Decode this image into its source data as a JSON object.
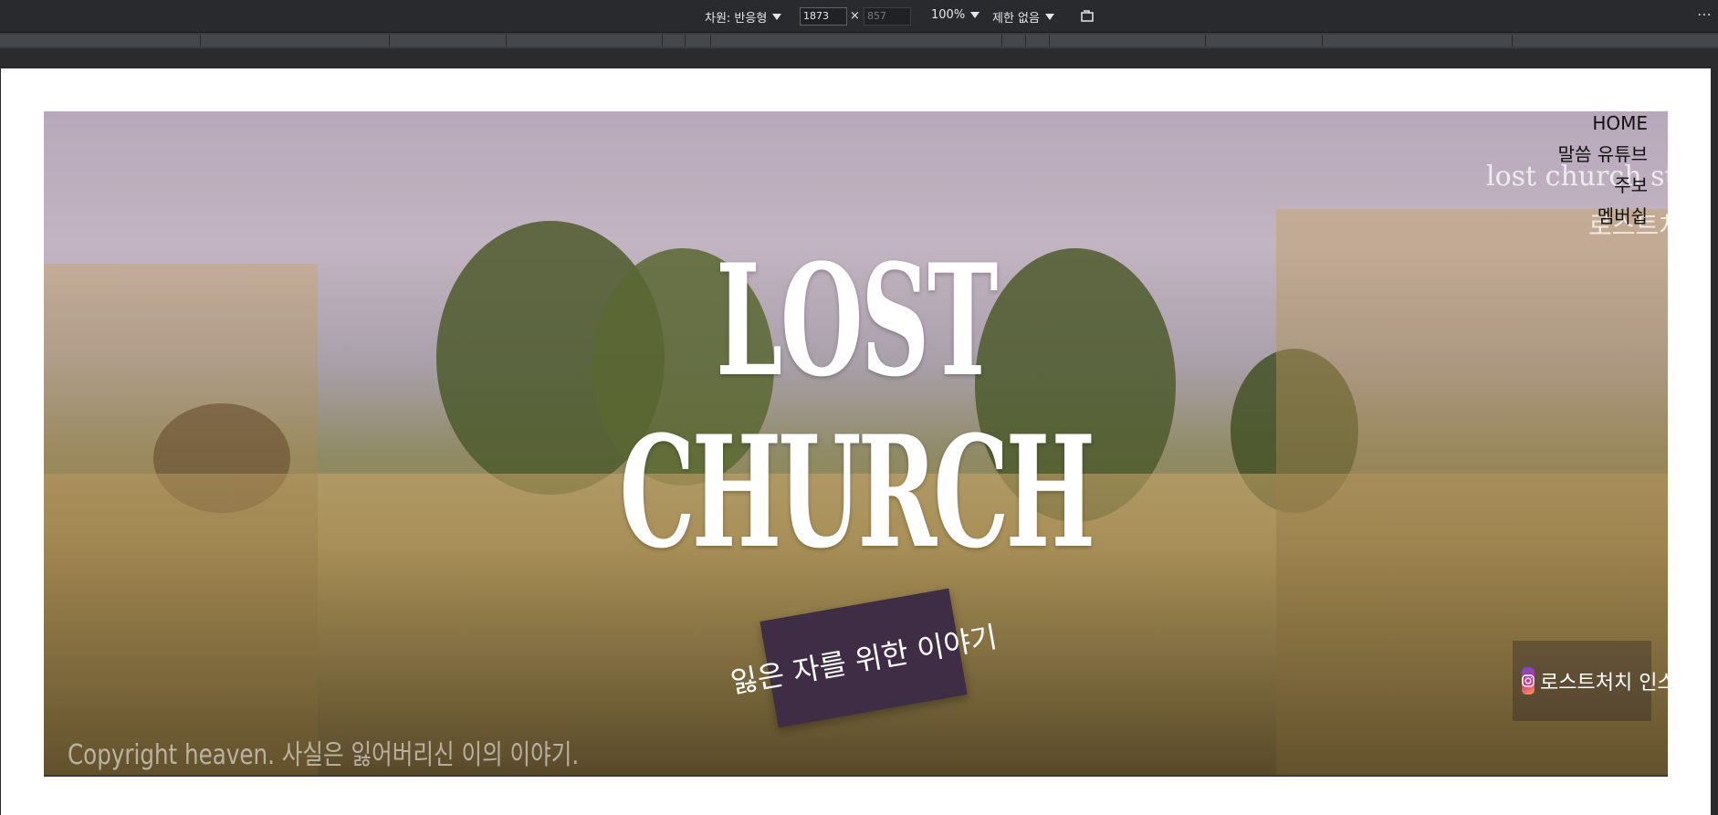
{
  "devtools": {
    "dimension_label": "차원: 반응형",
    "width_value": "1873",
    "height_placeholder": "857",
    "times_sign": "×",
    "zoom_label": "100%",
    "throttle_label": "제한 없음",
    "more_label": "⋯"
  },
  "site": {
    "nav": {
      "home": "HOME",
      "sermon_youtube": "말씀 유튜브",
      "bulletin": "주보",
      "membership": "멤버쉽"
    },
    "overlay_script": "lost church story",
    "overlay_korean": "로스트처치",
    "title_line1": "LOST",
    "title_line2": "CHURCH",
    "tagline": "잃은 자를 위한 이야기",
    "copyright": "Copyright heaven. 사실은 잃어버리신 이의 이야기.",
    "instagram_label": "로스트처치 인스타"
  },
  "colors": {
    "devtools_bg": "#292a2d",
    "tagline_bg": "#3f2c45",
    "nav_text": "#111111"
  },
  "icons": [
    "caret-down-icon",
    "rotate-icon",
    "more-icon",
    "instagram-icon"
  ]
}
